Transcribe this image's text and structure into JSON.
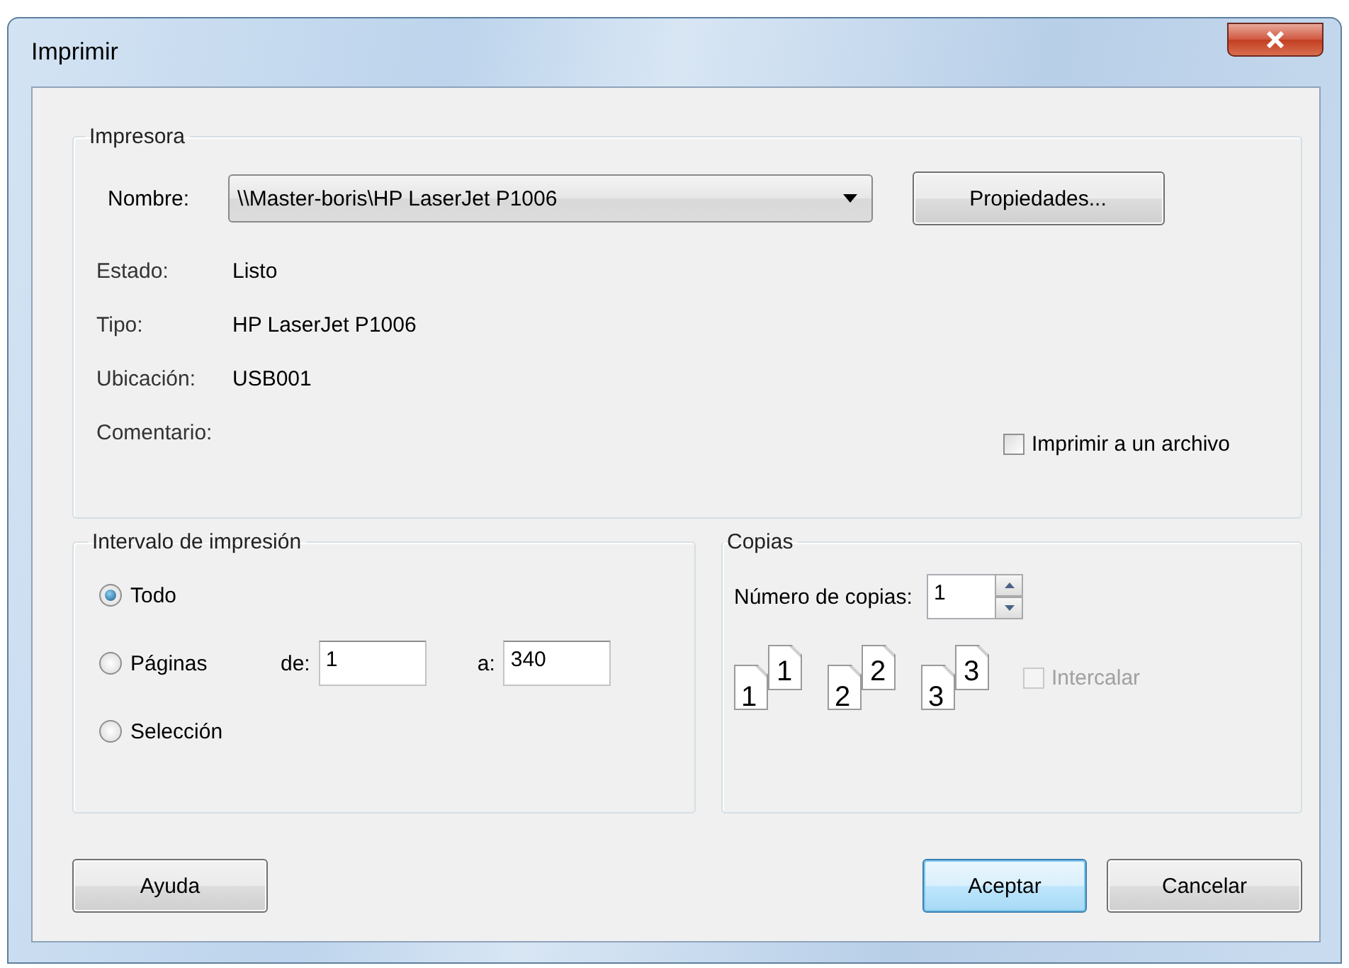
{
  "window": {
    "title": "Imprimir"
  },
  "printer": {
    "title": "Impresora",
    "name_label": "Nombre:",
    "name_value": "\\\\Master-boris\\HP LaserJet P1006",
    "properties_button": "Propiedades...",
    "details": [
      {
        "label": "Estado:",
        "value": "Listo"
      },
      {
        "label": "Tipo:",
        "value": "HP LaserJet P1006"
      },
      {
        "label": "Ubicación:",
        "value": "USB001"
      },
      {
        "label": "Comentario:"
      }
    ],
    "print_to_file": {
      "label": "Imprimir a un archivo",
      "checked": false
    }
  },
  "print_range": {
    "title": "Intervalo de impresión",
    "options": [
      {
        "label": "Todo",
        "selected": true
      },
      {
        "label": "Páginas",
        "selected": false
      },
      {
        "label": "Selección",
        "selected": false
      }
    ],
    "from_label": "de:",
    "from_value": "1",
    "to_label": "a:",
    "to_value": "340"
  },
  "copies": {
    "title": "Copias",
    "count_label": "Número de copias:",
    "count_value": "1",
    "collate_pages": [
      {
        "front": "1",
        "back": "1"
      },
      {
        "front": "2",
        "back": "2"
      },
      {
        "front": "3",
        "back": "3"
      }
    ],
    "collate": {
      "label": "Intercalar",
      "checked": false,
      "disabled": true
    }
  },
  "buttons": [
    {
      "label": "Ayuda",
      "default": false
    },
    {
      "label": "Aceptar",
      "default": true
    },
    {
      "label": "Cancelar",
      "default": false
    }
  ]
}
